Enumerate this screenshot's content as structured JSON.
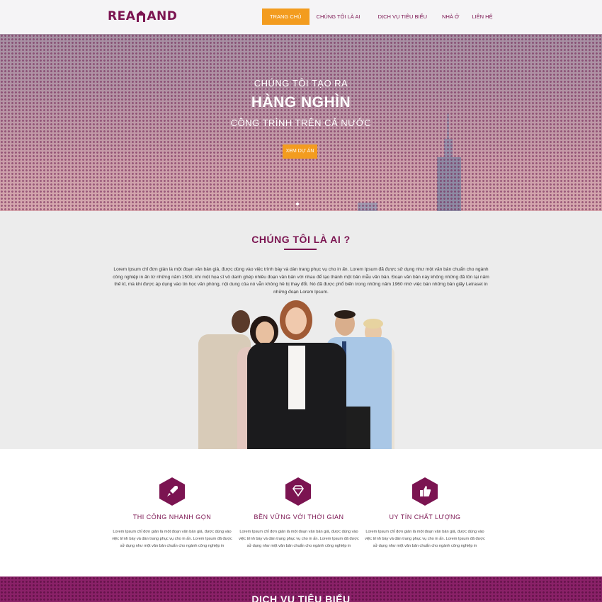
{
  "header": {
    "logo": {
      "left": "REA",
      "right": "AND"
    },
    "nav": [
      {
        "label": "TRANG CHỦ",
        "active": true
      },
      {
        "label": "CHÚNG TÔI LÀ AI",
        "active": false
      },
      {
        "label": "DỊCH VỤ TIÊU BIỂU",
        "active": false
      },
      {
        "label": "NHÀ Ở",
        "active": false
      },
      {
        "label": "LIÊN HỆ",
        "active": false
      }
    ]
  },
  "hero": {
    "line1": "CHÚNG TÔI TẠO RA",
    "line2": "HÀNG NGHÌN",
    "line3": "CÔNG TRÌNH TRÊN CẢ NƯỚC",
    "button": "XEM DỰ ÁN"
  },
  "about": {
    "title": "CHÚNG TÔI LÀ AI ?",
    "text": "Lorem Ipsum chỉ đơn giản là một đoạn văn bản giả, được dùng vào việc trình bày và dàn trang phục vụ cho in ấn. Lorem Ipsum đã được sử dụng như một văn bản chuẩn cho ngành công nghiệp in ấn từ những năm 1500, khi một họa sĩ vô danh ghép nhiều đoạn văn bản với nhau để tạo thành một bản mẫu văn bản. Đoạn văn bản này không những đã tồn tại năm thế kỉ, mà khi được áp dụng vào tin học văn phòng, nội dung của nó vẫn không hề bị thay đổi. Nó đã được phổ biến trong những năm 1960 nhờ việc bán những bản giấy Letraset in những đoạn Lorem Ipsum."
  },
  "features": [
    {
      "icon": "rocket-icon",
      "title": "THI CÔNG NHANH GỌN",
      "text": "Lorem Ipsum chỉ đơn giản là một đoạn văn bản giả, được dùng vào việc trình bày và dàn trang phục vụ cho in ấn. Lorem Ipsum đã được sử dụng như một văn bản chuẩn cho ngành công nghiệp in"
    },
    {
      "icon": "diamond-icon",
      "title": "BỀN VỮNG VỚI THỜI GIAN",
      "text": "Lorem Ipsum chỉ đơn giản là một đoạn văn bản giả, được dùng vào việc trình bày và dàn trang phục vụ cho in ấn. Lorem Ipsum đã được sử dụng như một văn bản chuẩn cho ngành công nghiệp in"
    },
    {
      "icon": "thumbs-up-icon",
      "title": "UY TÍN CHẤT LƯỢNG",
      "text": "Lorem Ipsum chỉ đơn giản là một đoạn văn bản giả, được dùng vào việc trình bày và dàn trang phục vụ cho in ấn. Lorem Ipsum đã được sử dụng như một văn bản chuẩn cho ngành công nghiệp in"
    }
  ],
  "services": {
    "title": "DỊCH VỤ TIÊU BIỂU"
  },
  "colors": {
    "brand": "#7b1451",
    "accent": "#f39c1f"
  }
}
